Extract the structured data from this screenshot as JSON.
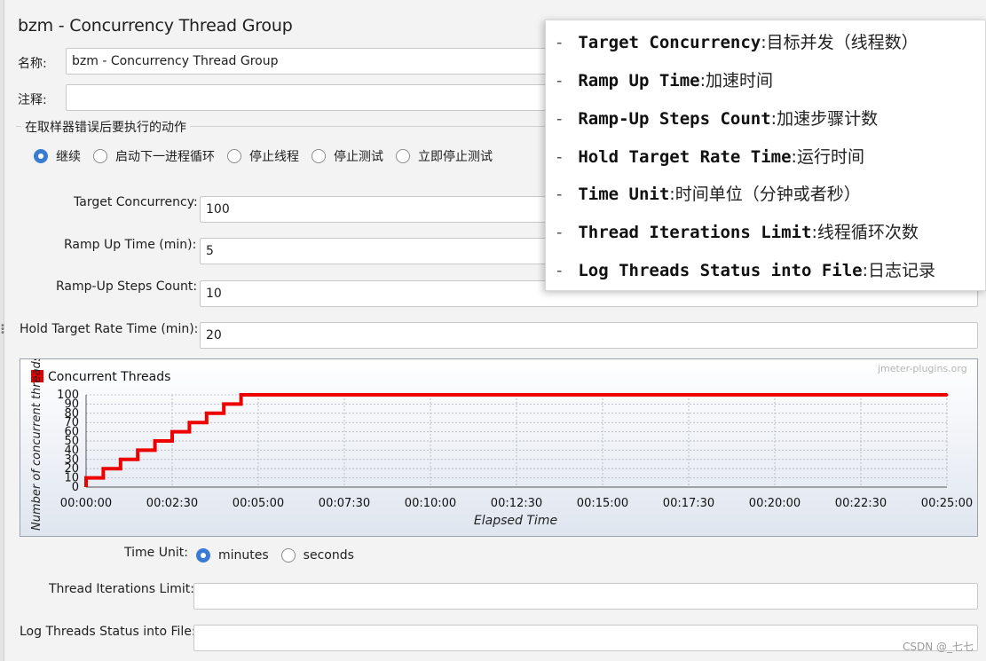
{
  "header": {
    "title": "bzm - Concurrency Thread Group"
  },
  "name_label": "名称:",
  "name_value": "bzm - Concurrency Thread Group",
  "comment_label": "注释:",
  "comment_value": "",
  "sampler_error": {
    "legend": "在取样器错误后要执行的动作",
    "options": [
      "继续",
      "启动下一进程循环",
      "停止线程",
      "停止测试",
      "立即停止测试"
    ],
    "selected": "继续"
  },
  "fields": {
    "target_concurrency": {
      "label": "Target Concurrency:",
      "value": "100"
    },
    "ramp_up_time": {
      "label": "Ramp Up Time (min):",
      "value": "5"
    },
    "ramp_up_steps": {
      "label": "Ramp-Up Steps Count:",
      "value": "10"
    },
    "hold_time": {
      "label": "Hold Target Rate Time (min):",
      "value": "20"
    },
    "time_unit": {
      "label": "Time Unit:",
      "options": [
        "minutes",
        "seconds"
      ],
      "selected": "minutes"
    },
    "iterations": {
      "label": "Thread Iterations Limit:",
      "value": ""
    },
    "log_threads": {
      "label": "Log Threads Status into File:",
      "value": ""
    }
  },
  "overlay": {
    "dash": "-",
    "items": [
      {
        "key": "Target Concurrency",
        "sep": ":",
        "val": "目标并发（线程数）"
      },
      {
        "key": "Ramp Up Time",
        "sep": ":",
        "val": "加速时间"
      },
      {
        "key": "Ramp-Up Steps Count",
        "sep": ":",
        "val": "加速步骤计数"
      },
      {
        "key": "Hold Target Rate Time",
        "sep": ":",
        "val": "运行时间"
      },
      {
        "key": "Time Unit",
        "sep": ":",
        "val": "时间单位（分钟或者秒）"
      },
      {
        "key": "Thread Iterations Limit",
        "sep": ":",
        "val": "线程循环次数"
      },
      {
        "key": "Log Threads Status into File",
        "sep": ":",
        "val": "日志记录"
      }
    ]
  },
  "watermark": "CSDN @_七七",
  "chart_data": {
    "type": "line",
    "legend": "Concurrent Threads",
    "brand": "jmeter-plugins.org",
    "xlabel": "Elapsed Time",
    "ylabel": "Number of concurrent threads",
    "ylim": [
      0,
      100
    ],
    "yticks": [
      0,
      10,
      20,
      30,
      40,
      50,
      60,
      70,
      80,
      90,
      100
    ],
    "xlim_seconds": [
      0,
      1500
    ],
    "xticks": [
      "00:00:00",
      "00:02:30",
      "00:05:00",
      "00:07:30",
      "00:10:00",
      "00:12:30",
      "00:15:00",
      "00:17:30",
      "00:20:00",
      "00:22:30",
      "00:25:00"
    ],
    "grid": true,
    "series": [
      {
        "name": "Concurrent Threads",
        "color": "#ee0000",
        "x_seconds": [
          0,
          30,
          60,
          90,
          120,
          150,
          180,
          210,
          240,
          270,
          1500
        ],
        "y": [
          10,
          20,
          30,
          40,
          50,
          60,
          70,
          80,
          90,
          100,
          100
        ]
      }
    ]
  }
}
